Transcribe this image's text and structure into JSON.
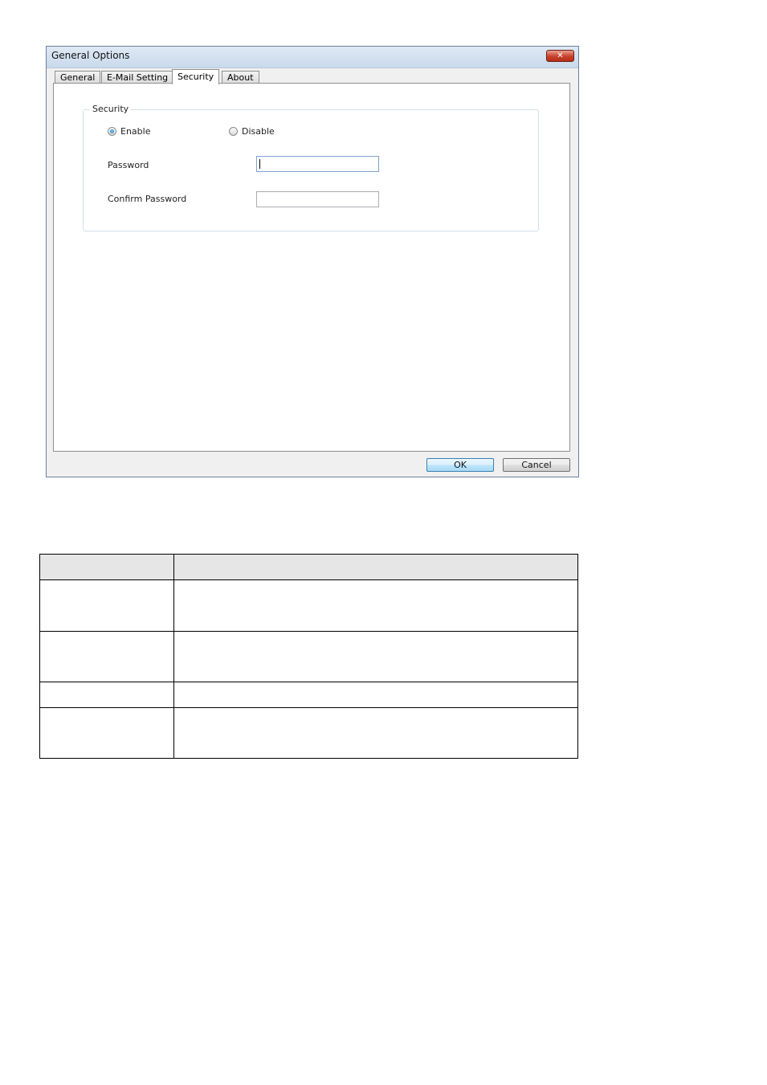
{
  "window": {
    "title": "General Options",
    "close_label": "✕"
  },
  "tabs": [
    {
      "label": "General",
      "active": false
    },
    {
      "label": "E-Mail Setting",
      "active": false
    },
    {
      "label": "Security",
      "active": true
    },
    {
      "label": "About",
      "active": false
    }
  ],
  "security": {
    "group_label": "Security",
    "enable_label": "Enable",
    "disable_label": "Disable",
    "selected": "enable",
    "password_label": "Password",
    "password_value": "",
    "confirm_label": "Confirm Password",
    "confirm_value": ""
  },
  "buttons": {
    "ok_label": "OK",
    "cancel_label": "Cancel"
  },
  "table": {
    "headers": [
      "",
      ""
    ],
    "rows": [
      [
        "",
        ""
      ],
      [
        "",
        ""
      ],
      [
        "",
        ""
      ],
      [
        "",
        ""
      ]
    ]
  },
  "colors": {
    "accent": "#3c7fb1",
    "close_button": "#c8412a"
  }
}
